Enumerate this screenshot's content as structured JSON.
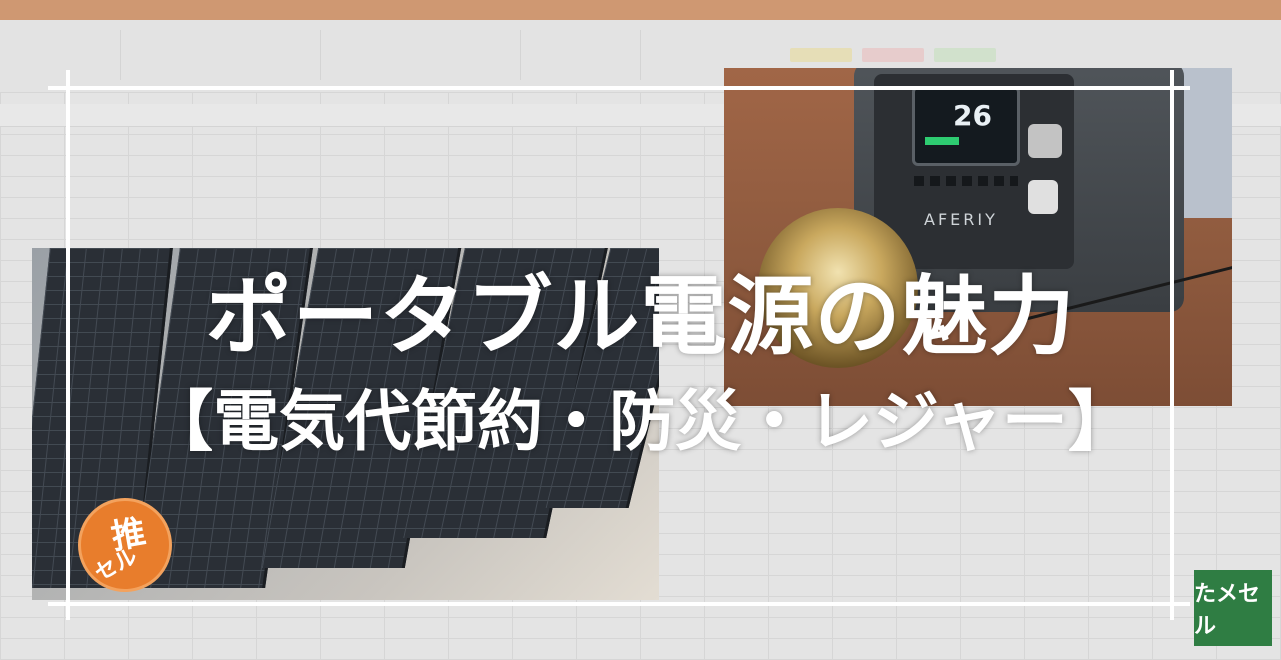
{
  "title": "ポータブル電源の魅力",
  "subtitle": "【電気代節約・防災・レジャー】",
  "photos": {
    "power_station": {
      "display_value": "26",
      "brand_text": "AFERIY"
    },
    "solar_panel": {}
  },
  "stamp": {
    "line1": "推",
    "line2": "セル"
  },
  "logo": {
    "text": "たメセル"
  },
  "colors": {
    "title_bar": "#c8733a",
    "stamp_orange": "#e87d2c",
    "logo_green": "#2f7d43",
    "frame_white": "#ffffff"
  }
}
